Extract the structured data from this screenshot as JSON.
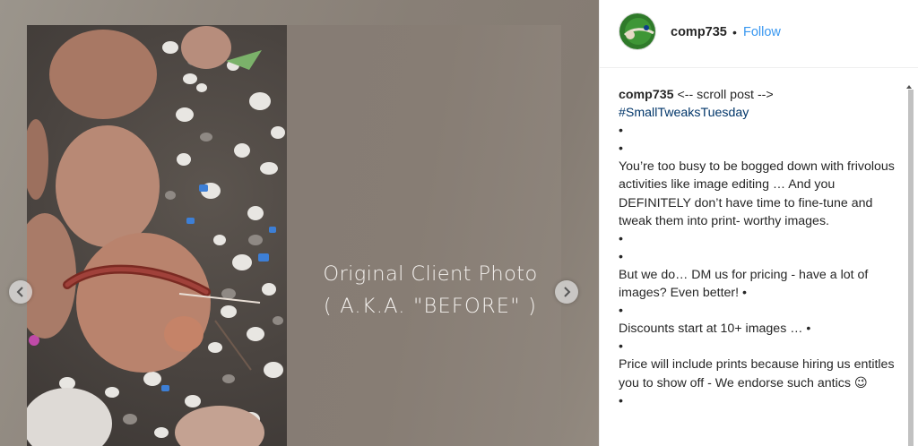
{
  "slide": {
    "caption_line1": "Original Client Photo",
    "caption_line2": "( A.K.A. \"BEFORE\" )"
  },
  "post_header": {
    "username": "comp735",
    "separator": "•",
    "follow_label": "Follow"
  },
  "caption": {
    "username": "comp735",
    "first_line_text": " <-- scroll post -->",
    "hashtag": "#SmallTweaksTuesday",
    "bullet": "•",
    "para1": "You’re too busy to be bogged down with frivolous activities like image editing … And you DEFINITELY don’t have time to fine-tune and tweak them into print- worthy images.",
    "para2": "But we do… DM us for pricing - have a lot of images? Even better! •",
    "para3": "Discounts start at 10+ images … •",
    "para4": "Price will include prints because hiring us entitles you to show off - We endorse such antics",
    "emoji": "😉"
  },
  "icons": {
    "prev": "chevron-left-icon",
    "next": "chevron-right-icon",
    "avatar": "profile-avatar",
    "scroll_up": "scroll-up-arrow-icon"
  },
  "colors": {
    "follow": "#3897f0",
    "hashtag": "#003569",
    "text": "#262626"
  }
}
